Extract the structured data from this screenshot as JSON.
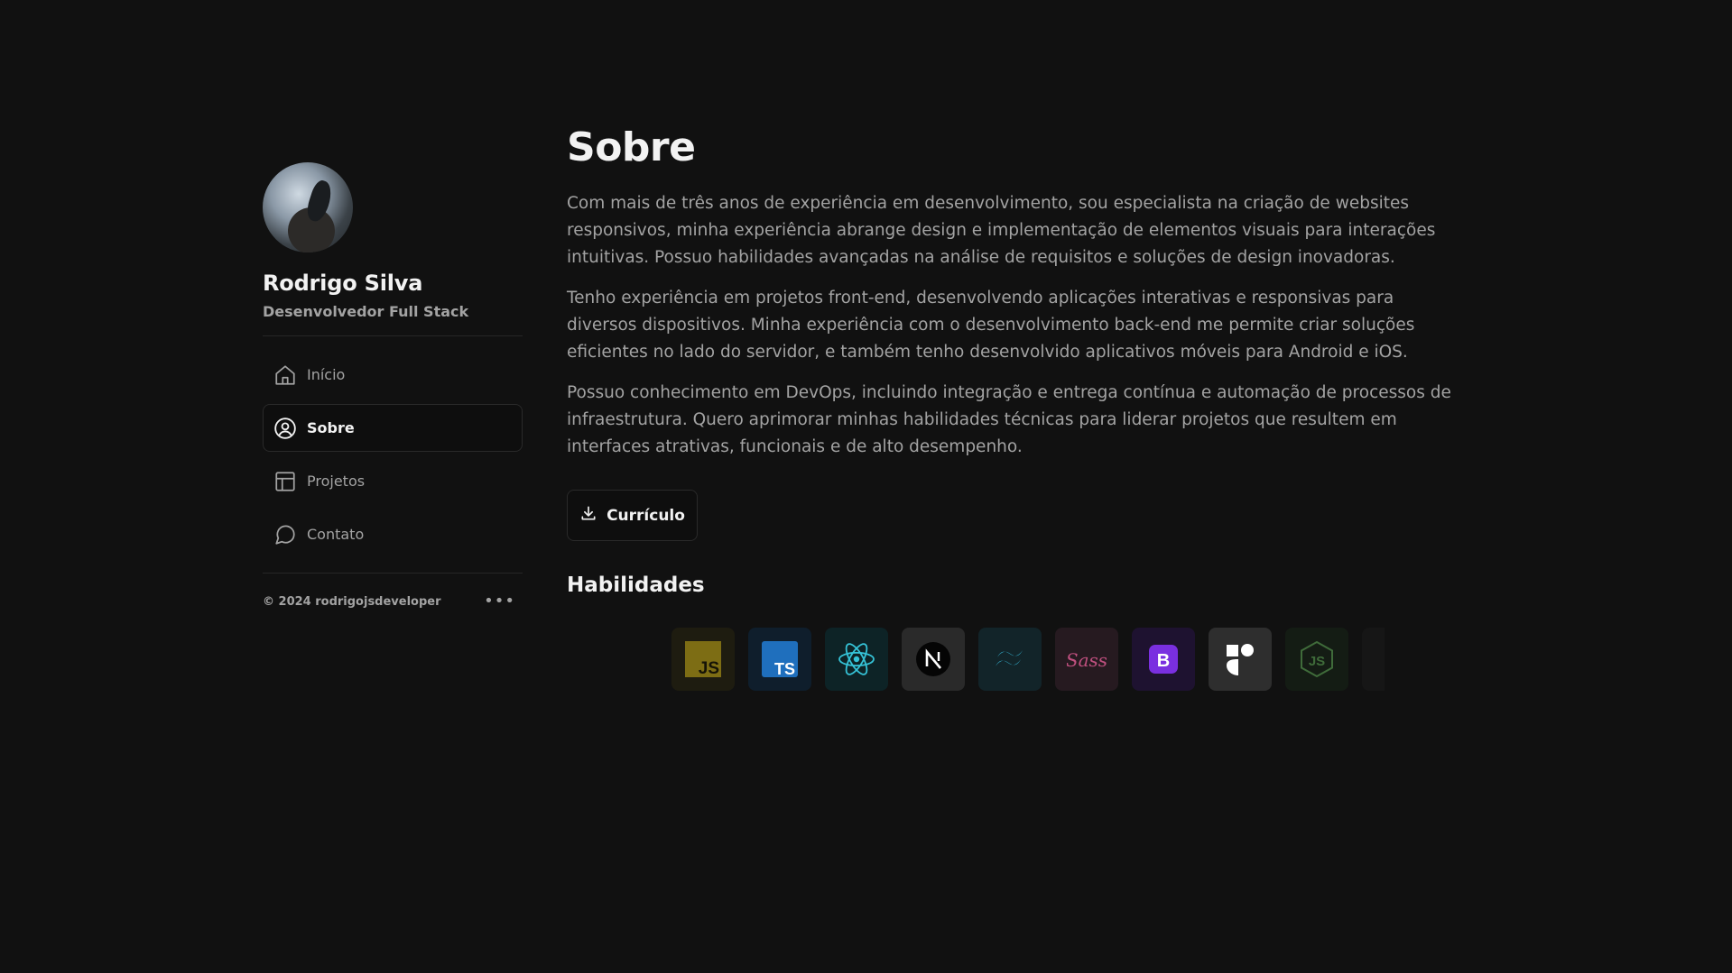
{
  "profile": {
    "name": "Rodrigo Silva",
    "role": "Desenvolvedor Full Stack"
  },
  "nav": [
    {
      "label": "Início",
      "icon": "home-icon",
      "active": false
    },
    {
      "label": "Sobre",
      "icon": "user-circle-icon",
      "active": true
    },
    {
      "label": "Projetos",
      "icon": "layout-icon",
      "active": false
    },
    {
      "label": "Contato",
      "icon": "message-circle-icon",
      "active": false
    }
  ],
  "footer": {
    "copyright": "© 2024 rodrigojsdeveloper",
    "more_icon": "more-horizontal-icon"
  },
  "main": {
    "title": "Sobre",
    "paragraphs": [
      "Com mais de três anos de experiência em desenvolvimento, sou especialista na criação de websites responsivos, minha experiência abrange design e implementação de elementos visuais para interações intuitivas. Possuo habilidades avançadas na análise de requisitos e soluções de design inovadoras.",
      "Tenho experiência em projetos front-end, desenvolvendo aplicações interativas e responsivas para diversos dispositivos. Minha experiência com o desenvolvimento back-end me permite criar soluções eficientes no lado do servidor, e também tenho desenvolvido aplicativos móveis para Android e iOS.",
      "Possuo conhecimento em DevOps, incluindo integração e entrega contínua e automação de processos de infraestrutura. Quero aprimorar minhas habilidades técnicas para liderar projetos que resultem em interfaces atrativas, funcionais e de alto desempenho."
    ],
    "cv_button": "Currículo",
    "skills_title": "Habilidades",
    "skills": [
      {
        "icon": "javascript-icon",
        "bg": "#1e1c10"
      },
      {
        "icon": "typescript-icon",
        "bg": "#0f1e2c"
      },
      {
        "icon": "react-icon",
        "bg": "#0d2326"
      },
      {
        "icon": "nextjs-icon",
        "bg": "#2a2a2a"
      },
      {
        "icon": "tailwind-icon",
        "bg": "#122429"
      },
      {
        "icon": "sass-icon",
        "bg": "#261a20"
      },
      {
        "icon": "bootstrap-icon",
        "bg": "#1e1230"
      },
      {
        "icon": "framer-icon",
        "bg": "#2e2e2e"
      },
      {
        "icon": "nodejs-icon",
        "bg": "#141c14"
      },
      {
        "icon": "more-skill-icon",
        "bg": "#161616"
      }
    ]
  },
  "colors": {
    "background": "#111111",
    "text_primary": "#f2f2f2",
    "text_muted": "#a3a3a3",
    "border": "#2a2a2a"
  }
}
